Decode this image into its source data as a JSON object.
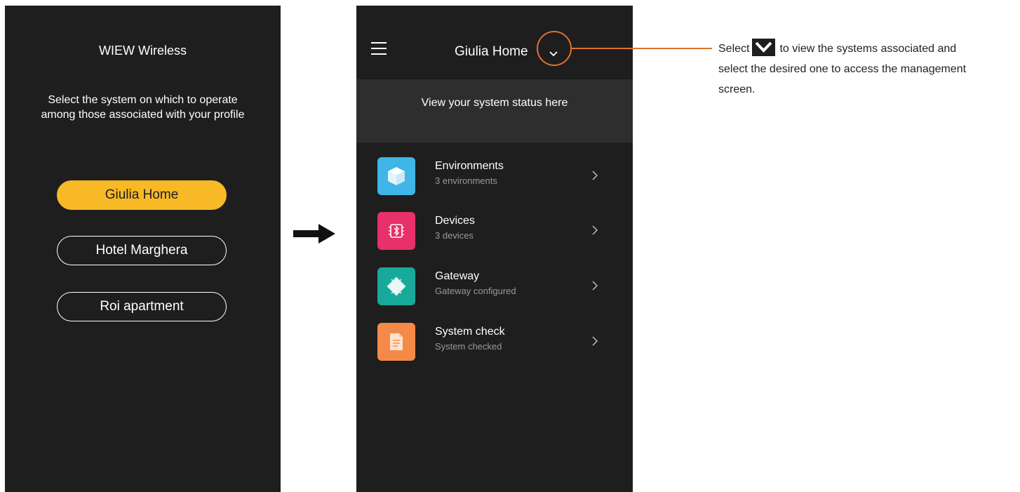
{
  "screen1": {
    "title": "WIEW Wireless",
    "instruction_line1": "Select the system on which to operate",
    "instruction_line2": "among those associated with your profile",
    "systems": [
      {
        "label": "Giulia Home",
        "selected": true
      },
      {
        "label": "Hotel Marghera",
        "selected": false
      },
      {
        "label": "Roi apartment",
        "selected": false
      }
    ]
  },
  "screen2": {
    "header_title": "Giulia Home",
    "status_text": "View your system status here",
    "menu": [
      {
        "title": "Environments",
        "subtitle": "3 environments",
        "icon": "cube-icon",
        "color": "#3fb5e8"
      },
      {
        "title": "Devices",
        "subtitle": "3 devices",
        "icon": "bluetooth-chip-icon",
        "color": "#e8306a"
      },
      {
        "title": "Gateway",
        "subtitle": "Gateway configured",
        "icon": "chip-icon",
        "color": "#17a99a"
      },
      {
        "title": "System check",
        "subtitle": "System checked",
        "icon": "document-icon",
        "color": "#f58a48"
      }
    ]
  },
  "annotation": {
    "text_before": "Select",
    "line1_rest": "to view the systems associated and",
    "line2": "select the desired one to access the management",
    "line3": "screen."
  },
  "colors": {
    "phone_bg": "#1e1e1e",
    "status_band": "#2e2e2e",
    "accent_yellow": "#f8b927",
    "callout_orange": "#e0702e"
  }
}
